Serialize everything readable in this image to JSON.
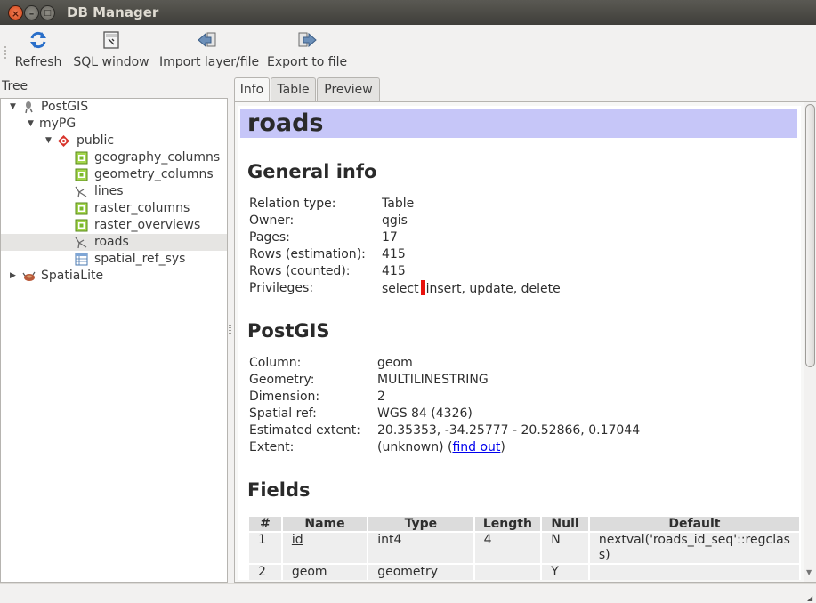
{
  "window": {
    "title": "DB Manager",
    "close_glyph": "×",
    "minimize_glyph": "–",
    "maximize_glyph": "□"
  },
  "toolbar": {
    "refresh_label": "Refresh",
    "sql_label": "SQL window",
    "import_label": "Import layer/file",
    "export_label": "Export to file"
  },
  "tree": {
    "label": "Tree",
    "items": [
      {
        "label": "PostGIS",
        "icon": "postgis-icon"
      },
      {
        "label": "myPG",
        "icon": "none"
      },
      {
        "label": "public",
        "icon": "schema-icon"
      },
      {
        "label": "geography_columns",
        "icon": "table-icon"
      },
      {
        "label": "geometry_columns",
        "icon": "table-icon"
      },
      {
        "label": "lines",
        "icon": "line-layer-icon"
      },
      {
        "label": "raster_columns",
        "icon": "table-icon"
      },
      {
        "label": "raster_overviews",
        "icon": "table-icon"
      },
      {
        "label": "roads",
        "icon": "line-layer-icon",
        "selected": true
      },
      {
        "label": "spatial_ref_sys",
        "icon": "grid-table-icon"
      },
      {
        "label": "SpatiaLite",
        "icon": "spatialite-icon"
      }
    ]
  },
  "tabs": [
    {
      "label": "Info",
      "active": true
    },
    {
      "label": "Table",
      "active": false
    },
    {
      "label": "Preview",
      "active": false
    }
  ],
  "info": {
    "title": "roads",
    "general_heading": "General info",
    "general": [
      {
        "key": "Relation type:",
        "value": "Table"
      },
      {
        "key": "Owner:",
        "value": "qgis"
      },
      {
        "key": "Pages:",
        "value": "17"
      },
      {
        "key": "Rows (estimation):",
        "value": "415"
      },
      {
        "key": "Rows (counted):",
        "value": "415"
      },
      {
        "key": "Privileges:",
        "value_before": "select",
        "value_after": "insert, update, delete"
      }
    ],
    "postgis_heading": "PostGIS",
    "postgis": [
      {
        "key": "Column:",
        "value": "geom"
      },
      {
        "key": "Geometry:",
        "value": "MULTILINESTRING"
      },
      {
        "key": "Dimension:",
        "value": "2"
      },
      {
        "key": "Spatial ref:",
        "value": "WGS 84 (4326)"
      },
      {
        "key": "Estimated extent:",
        "value": "20.35353, -34.25777 - 20.52866, 0.17044"
      }
    ],
    "extent": {
      "key": "Extent:",
      "prefix": "(unknown) (",
      "link": "find out",
      "suffix": ")"
    },
    "fields_heading": "Fields",
    "fields_columns": [
      "#",
      "Name",
      "Type",
      "Length",
      "Null",
      "Default"
    ],
    "fields_rows": [
      {
        "num": "1",
        "name": "id",
        "type": "int4",
        "length": "4",
        "null": "N",
        "default_line1": "nextval('roads_id_seq'::regclas",
        "default_line2": "s)"
      },
      {
        "num": "2",
        "name": "geom",
        "type": "geometry",
        "length": "",
        "null": "Y",
        "default_line1": "",
        "default_line2": ""
      }
    ]
  },
  "colors": {
    "title_background": "#c6c6f8",
    "privilege_marker": "#e8120d",
    "link": "#0000ee"
  }
}
